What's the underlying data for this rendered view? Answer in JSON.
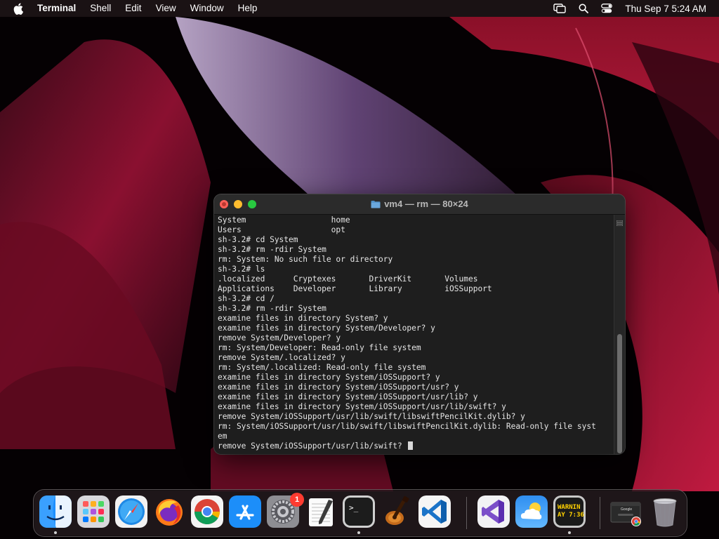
{
  "menubar": {
    "apple_icon": "apple-logo-icon",
    "app_name": "Terminal",
    "menus": [
      "Shell",
      "Edit",
      "View",
      "Window",
      "Help"
    ],
    "clock": "Thu Sep 7  5:24 AM",
    "status_icons": [
      "screen-mirroring-icon",
      "search-icon",
      "control-center-icon"
    ]
  },
  "terminal": {
    "title": "vm4 — rm — 80×24",
    "lines": [
      {
        "text": "System                  home",
        "prompt": false
      },
      {
        "text": "Users                   opt",
        "prompt": false
      },
      {
        "text": "sh-3.2# cd System",
        "prompt": true
      },
      {
        "text": "sh-3.2# rm -rdir System",
        "prompt": true
      },
      {
        "text": "rm: System: No such file or directory",
        "prompt": false
      },
      {
        "text": "sh-3.2# ls",
        "prompt": true
      },
      {
        "text": ".localized      Cryptexes       DriverKit       Volumes",
        "prompt": false
      },
      {
        "text": "Applications    Developer       Library         iOSSupport",
        "prompt": false
      },
      {
        "text": "sh-3.2# cd /",
        "prompt": true
      },
      {
        "text": "sh-3.2# rm -rdir System",
        "prompt": true
      },
      {
        "text": "examine files in directory System? y",
        "prompt": false
      },
      {
        "text": "examine files in directory System/Developer? y",
        "prompt": false
      },
      {
        "text": "remove System/Developer? y",
        "prompt": false
      },
      {
        "text": "rm: System/Developer: Read-only file system",
        "prompt": false
      },
      {
        "text": "remove System/.localized? y",
        "prompt": false
      },
      {
        "text": "rm: System/.localized: Read-only file system",
        "prompt": false
      },
      {
        "text": "examine files in directory System/iOSSupport? y",
        "prompt": false
      },
      {
        "text": "examine files in directory System/iOSSupport/usr? y",
        "prompt": false
      },
      {
        "text": "examine files in directory System/iOSSupport/usr/lib? y",
        "prompt": false
      },
      {
        "text": "examine files in directory System/iOSSupport/usr/lib/swift? y",
        "prompt": false
      },
      {
        "text": "remove System/iOSSupport/usr/lib/swift/libswiftPencilKit.dylib? y",
        "prompt": false
      },
      {
        "text": "rm: System/iOSSupport/usr/lib/swift/libswiftPencilKit.dylib: Read-only file syst",
        "prompt": false
      },
      {
        "text": "em",
        "prompt": false
      },
      {
        "text": "remove System/iOSSupport/usr/lib/swift? ",
        "prompt": false,
        "cursor": true
      }
    ]
  },
  "dock": {
    "apps": [
      {
        "name": "Finder",
        "icon": "finder-icon",
        "running": true
      },
      {
        "name": "Launchpad",
        "icon": "launchpad-icon",
        "running": false
      },
      {
        "name": "Safari",
        "icon": "safari-icon",
        "running": false
      },
      {
        "name": "Firefox",
        "icon": "firefox-icon",
        "running": false
      },
      {
        "name": "Chrome",
        "icon": "chrome-icon",
        "running": false
      },
      {
        "name": "App Store",
        "icon": "app-store-icon",
        "running": false
      },
      {
        "name": "System Settings",
        "icon": "system-settings-icon",
        "running": false,
        "badge": "1"
      },
      {
        "name": "TextEdit",
        "icon": "textedit-icon",
        "running": false
      },
      {
        "name": "Terminal",
        "icon": "terminal-icon",
        "running": true
      },
      {
        "name": "GarageBand",
        "icon": "garageband-icon",
        "running": false
      },
      {
        "name": "VS Code",
        "icon": "vscode-icon",
        "running": false
      },
      {
        "name": "Visual Studio",
        "icon": "visual-studio-icon",
        "running": false
      },
      {
        "name": "Weather",
        "icon": "weather-icon",
        "running": false
      },
      {
        "name": "Console",
        "icon": "console-icon",
        "running": true
      },
      {
        "name": "Chrome Window",
        "icon": "chrome-window-icon",
        "running": false
      },
      {
        "name": "Trash",
        "icon": "trash-icon",
        "running": false
      }
    ],
    "terminal_glyph": ">_",
    "console_text_1": "WARNIN",
    "console_text_2": "AY 7:36",
    "chrome_window_label": "Google"
  }
}
